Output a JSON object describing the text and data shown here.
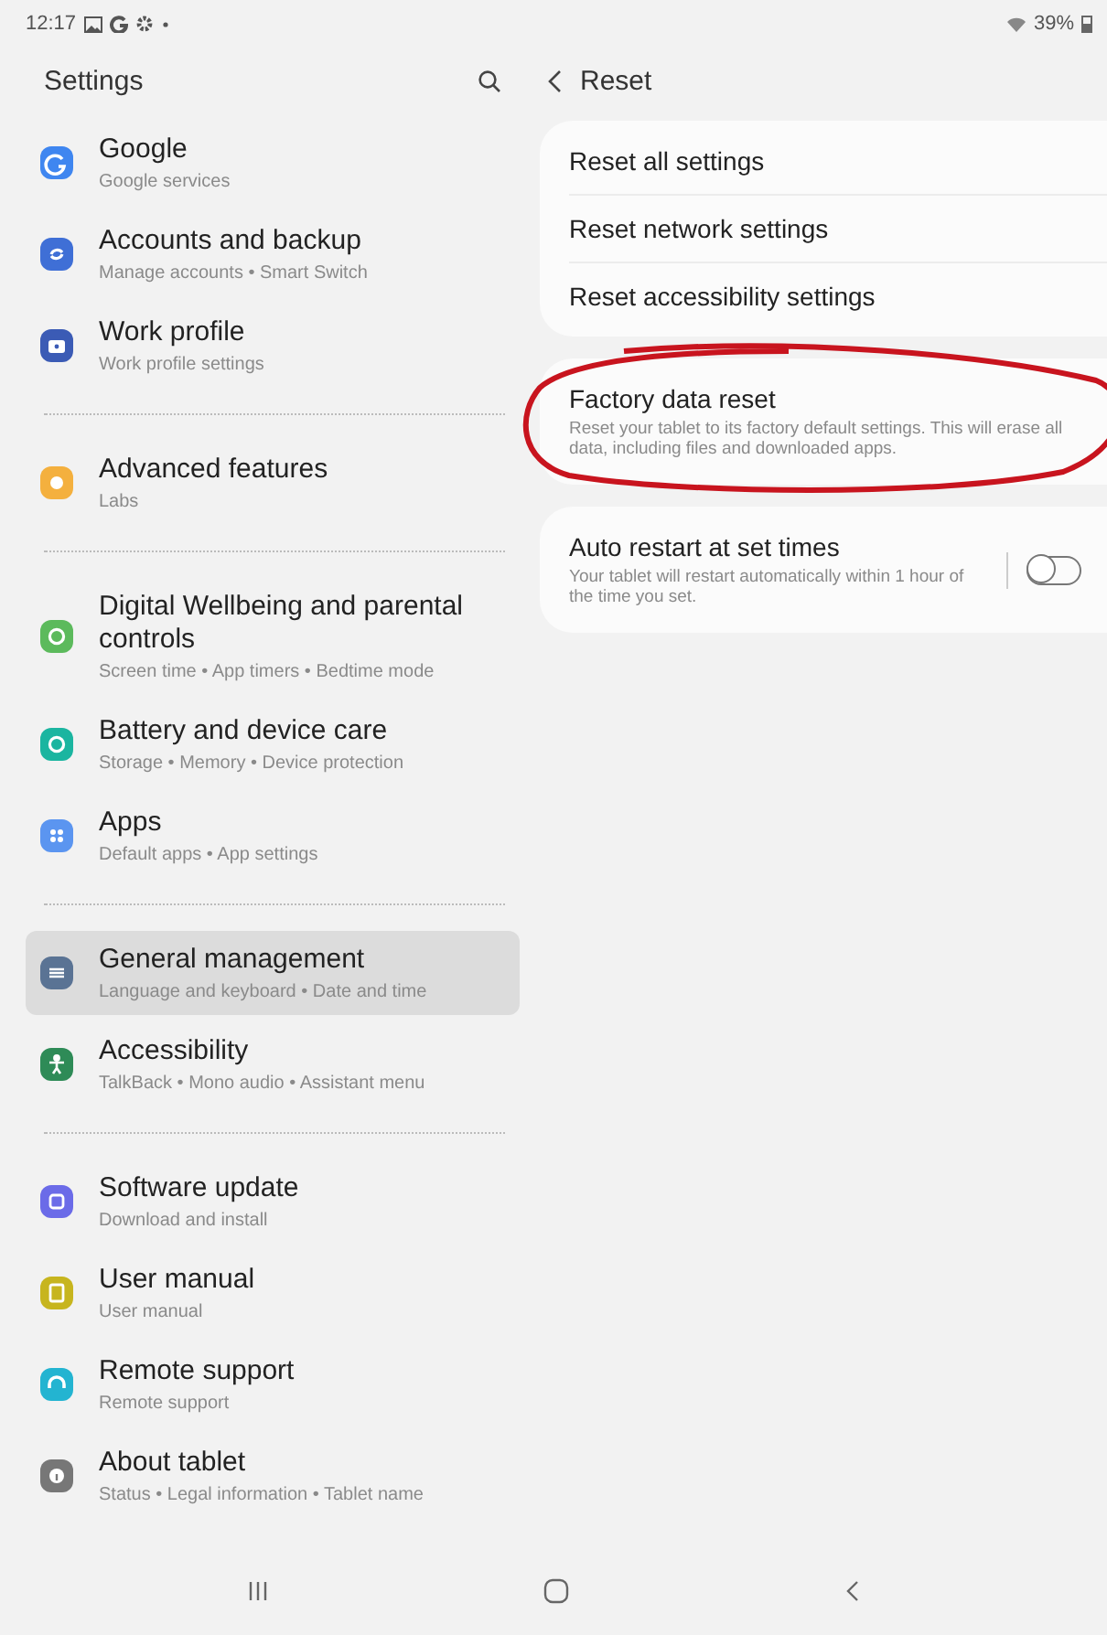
{
  "status_bar": {
    "time": "12:17",
    "battery": "39%"
  },
  "sidebar": {
    "title": "Settings",
    "groups": [
      {
        "items": [
          {
            "title": "Google",
            "subtitle": "Google services",
            "color": "#3f86f0",
            "selected": false
          },
          {
            "title": "Accounts and backup",
            "subtitle": "Manage accounts  •  Smart Switch",
            "color": "#3f6fd6",
            "selected": false
          },
          {
            "title": "Work profile",
            "subtitle": "Work profile settings",
            "color": "#3b5bb5",
            "selected": false
          }
        ]
      },
      {
        "items": [
          {
            "title": "Advanced features",
            "subtitle": "Labs",
            "color": "#f4b03e",
            "selected": false
          }
        ]
      },
      {
        "items": [
          {
            "title": "Digital Wellbeing and parental controls",
            "subtitle": "Screen time  •  App timers  •  Bedtime mode",
            "color": "#5cba5c",
            "selected": false
          },
          {
            "title": "Battery and device care",
            "subtitle": "Storage  •  Memory  •  Device protection",
            "color": "#1bb5a0",
            "selected": false
          },
          {
            "title": "Apps",
            "subtitle": "Default apps  •  App settings",
            "color": "#5b95f0",
            "selected": false
          }
        ]
      },
      {
        "items": [
          {
            "title": "General management",
            "subtitle": "Language and keyboard  •  Date and time",
            "color": "#5a7394",
            "selected": true
          },
          {
            "title": "Accessibility",
            "subtitle": "TalkBack  •  Mono audio  •  Assistant menu",
            "color": "#2e8b57",
            "selected": false
          }
        ]
      },
      {
        "items": [
          {
            "title": "Software update",
            "subtitle": "Download and install",
            "color": "#6b6be8",
            "selected": false
          },
          {
            "title": "User manual",
            "subtitle": "User manual",
            "color": "#c7b51e",
            "selected": false
          },
          {
            "title": "Remote support",
            "subtitle": "Remote support",
            "color": "#23b4d1",
            "selected": false
          },
          {
            "title": "About tablet",
            "subtitle": "Status  •  Legal information  •  Tablet name",
            "color": "#777777",
            "selected": false
          }
        ]
      }
    ]
  },
  "detail": {
    "title": "Reset",
    "cards": [
      {
        "items": [
          {
            "kind": "plain",
            "title": "Reset all settings",
            "circled": false
          },
          {
            "kind": "plain",
            "title": "Reset network settings",
            "circled": false
          },
          {
            "kind": "plain",
            "title": "Reset accessibility settings",
            "circled": false
          }
        ]
      },
      {
        "items": [
          {
            "kind": "plain",
            "title": "Factory data reset",
            "description": "Reset your tablet to its factory default settings. This will erase all data, including files and downloaded apps.",
            "circled": true
          }
        ]
      },
      {
        "items": [
          {
            "kind": "toggle",
            "title": "Auto restart at set times",
            "description": "Your tablet will restart automatically within 1 hour of the time you set.",
            "on": false,
            "circled": false
          }
        ]
      }
    ]
  }
}
